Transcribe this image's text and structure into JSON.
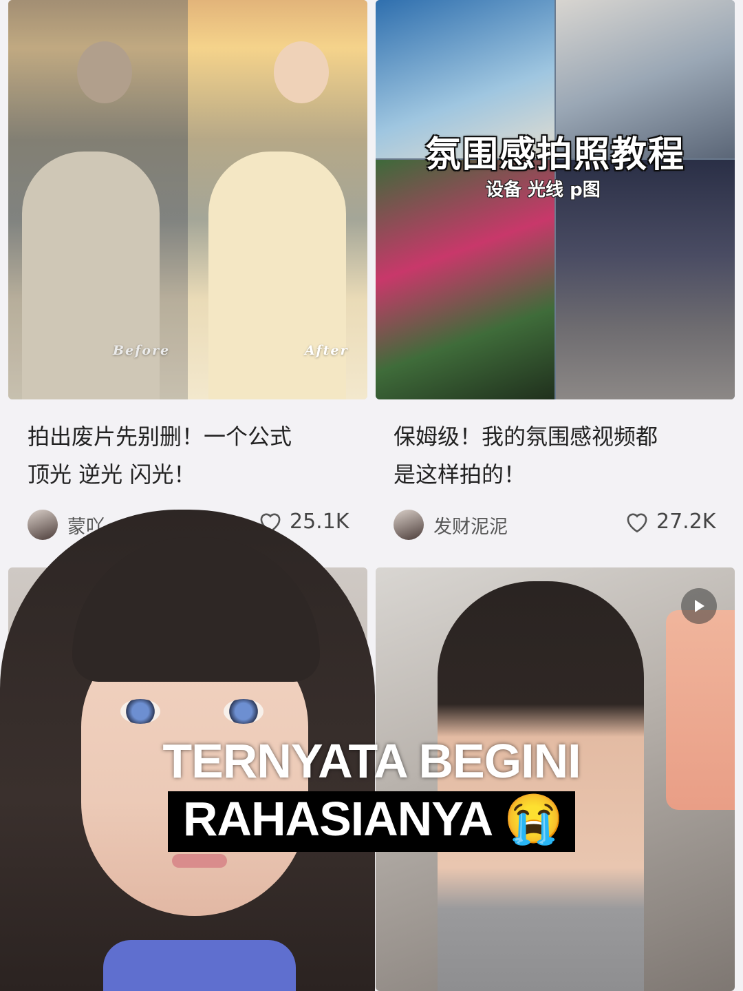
{
  "feed": {
    "cards": [
      {
        "image_labels": {
          "before": "Before",
          "after": "After"
        },
        "title_line1": "拍出废片先别删！一个公式",
        "title_line2": "顶光 逆光 闪光！",
        "author": "蒙吖",
        "likes": "25.1K"
      },
      {
        "banner_title": "氛围感拍照教程",
        "banner_subtitle": "设备 光线 p图",
        "title_line1": "保姆级！我的氛围感视频都",
        "title_line2": "是这样拍的！",
        "author": "发财泥泥",
        "likes": "27.2K"
      }
    ]
  },
  "overlay": {
    "caption_line1": "TERNYATA BEGINI",
    "caption_line2": "RAHASIANYA 😭"
  },
  "icons": {
    "like": "heart-icon",
    "video": "play-icon"
  },
  "colors": {
    "background": "#f3f2f5",
    "text": "#222222",
    "caption_bg": "#000000"
  }
}
